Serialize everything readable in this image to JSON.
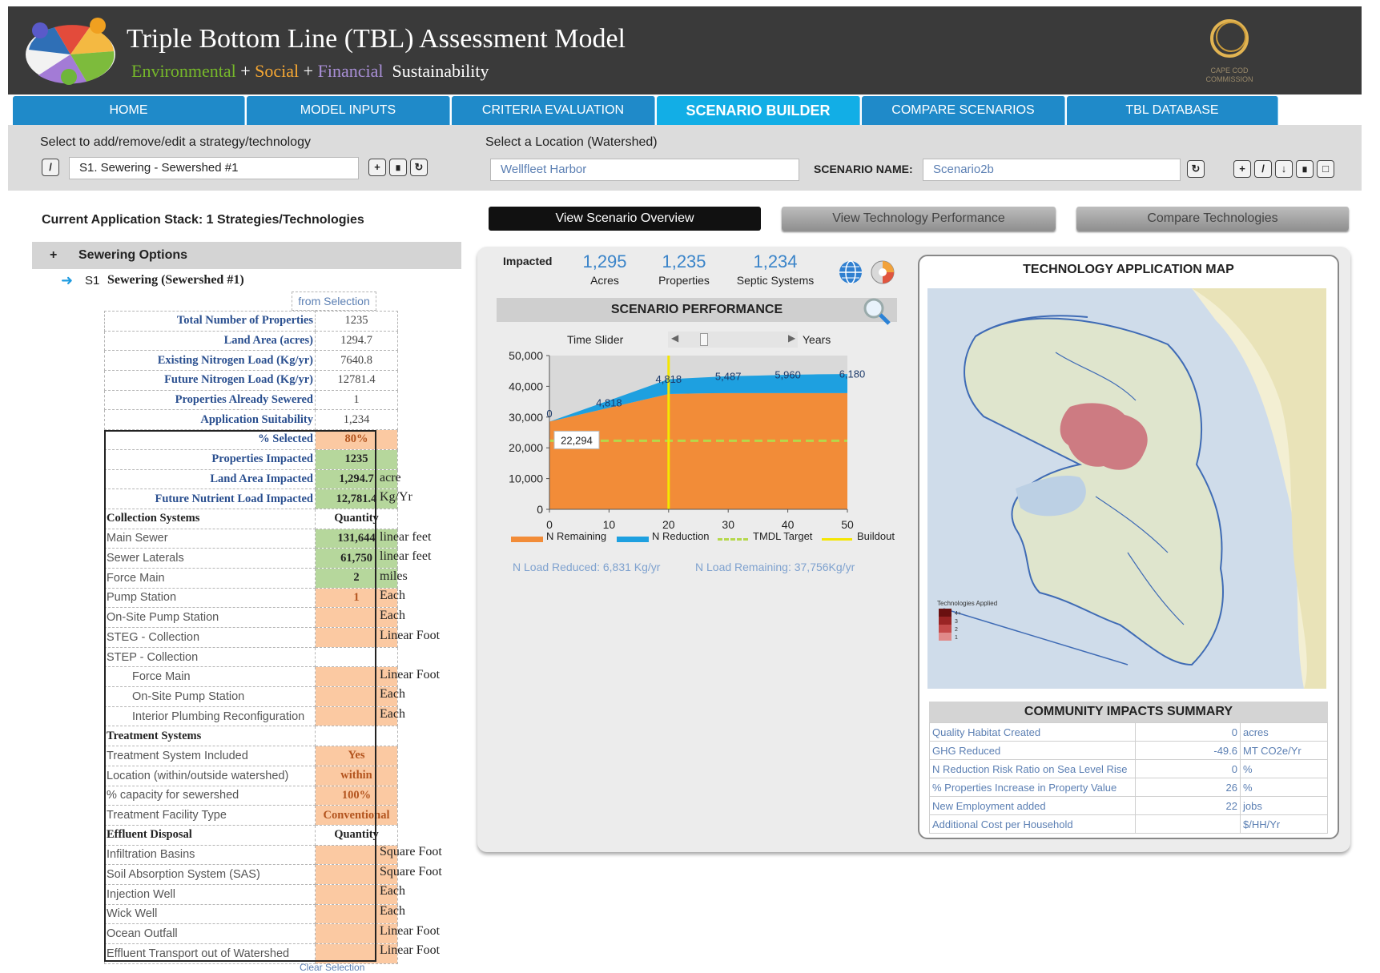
{
  "app": {
    "title": "Triple Bottom Line (TBL) Assessment Model",
    "subtitle": {
      "environmental": "Environmental",
      "social": "Social",
      "financial": "Financial",
      "sustainability": "Sustainability",
      "plus": "+"
    },
    "commission_logo": "CAPE COD COMMISSION"
  },
  "nav": {
    "tabs": [
      {
        "label": "HOME",
        "active": false
      },
      {
        "label": "MODEL INPUTS",
        "active": false
      },
      {
        "label": "CRITERIA EVALUATION",
        "active": false
      },
      {
        "label": "SCENARIO BUILDER",
        "active": true
      },
      {
        "label": "COMPARE SCENARIOS",
        "active": false
      },
      {
        "label": "TBL DATABASE",
        "active": false
      }
    ]
  },
  "toolbar": {
    "strategy_label": "Select to add/remove/edit a strategy/technology",
    "strategy_value": "S1. Sewering - Sewershed #1",
    "location_label": "Select a Location (Watershed)",
    "location_value": "Wellfleet Harbor",
    "scenario_name_label": "SCENARIO NAME:",
    "scenario_name_value": "Scenario2b"
  },
  "left": {
    "stack_title": "Current Application Stack: 1 Strategies/Technologies",
    "group": {
      "toggle": "+",
      "label": "Sewering Options"
    },
    "item": {
      "code": "S1",
      "label": "Sewering (Sewershed #1)"
    },
    "from_selection": "from Selection",
    "clear_selection": "Clear Selection",
    "rows": [
      {
        "label": "Total Number of Properties",
        "value": "1235",
        "unit": "",
        "type": "info"
      },
      {
        "label": "Land Area (acres)",
        "value": "1294.7",
        "unit": "",
        "type": "info"
      },
      {
        "label": "Existing Nitrogen Load (Kg/yr)",
        "value": "7640.8",
        "unit": "",
        "type": "info"
      },
      {
        "label": "Future Nitrogen Load (Kg/yr)",
        "value": "12781.4",
        "unit": "",
        "type": "info"
      },
      {
        "label": "Properties Already Sewered",
        "value": "1",
        "unit": "",
        "type": "info"
      },
      {
        "label": "Application Suitability",
        "value": "1,234",
        "unit": "",
        "type": "info"
      },
      {
        "label": "% Selected",
        "value": "80%",
        "unit": "",
        "type": "orange"
      },
      {
        "label": "Properties Impacted",
        "value": "1235",
        "unit": "",
        "type": "green"
      },
      {
        "label": "Land Area Impacted",
        "value": "1,294.7",
        "unit": "acre",
        "type": "green"
      },
      {
        "label": "Future Nutrient Load Impacted",
        "value": "12,781.4",
        "unit": "Kg/Yr",
        "type": "green"
      },
      {
        "label": "Collection Systems",
        "value": "Quantity",
        "unit": "",
        "type": "section"
      },
      {
        "label": "Main Sewer",
        "value": "131,644",
        "unit": "linear feet",
        "type": "green-sub"
      },
      {
        "label": "Sewer Laterals",
        "value": "61,750",
        "unit": "linear feet",
        "type": "green-sub"
      },
      {
        "label": "Force Main",
        "value": "2",
        "unit": "miles",
        "type": "green-sub"
      },
      {
        "label": "Pump Station",
        "value": "1",
        "unit": "Each",
        "type": "orange-sub"
      },
      {
        "label": "On-Site Pump Station",
        "value": "",
        "unit": "Each",
        "type": "orange-sub"
      },
      {
        "label": "STEG - Collection",
        "value": "",
        "unit": "Linear Foot",
        "type": "orange-sub"
      },
      {
        "label": "STEP - Collection",
        "value": "",
        "unit": "",
        "type": "plain-sub"
      },
      {
        "label": "Force Main",
        "value": "",
        "unit": "Linear Foot",
        "type": "orange-ind"
      },
      {
        "label": "On-Site Pump Station",
        "value": "",
        "unit": "Each",
        "type": "orange-ind"
      },
      {
        "label": "Interior Plumbing Reconfiguration",
        "value": "",
        "unit": "Each",
        "type": "orange-ind"
      },
      {
        "label": "Treatment Systems",
        "value": "",
        "unit": "",
        "type": "section"
      },
      {
        "label": "Treatment System Included",
        "value": "Yes",
        "unit": "",
        "type": "orange-sub"
      },
      {
        "label": "Location (within/outside watershed)",
        "value": "within",
        "unit": "",
        "type": "orange-sub"
      },
      {
        "label": "% capacity for sewershed",
        "value": "100%",
        "unit": "",
        "type": "orange-sub"
      },
      {
        "label": "Treatment Facility Type",
        "value": "Conventional",
        "unit": "",
        "type": "orange-sub"
      },
      {
        "label": "Effluent Disposal",
        "value": "Quantity",
        "unit": "",
        "type": "section"
      },
      {
        "label": "Infiltration Basins",
        "value": "",
        "unit": "Square Foot",
        "type": "orange-sub"
      },
      {
        "label": "Soil Absorption System (SAS)",
        "value": "",
        "unit": "Square Foot",
        "type": "orange-sub"
      },
      {
        "label": "Injection Well",
        "value": "",
        "unit": "Each",
        "type": "orange-sub"
      },
      {
        "label": "Wick Well",
        "value": "",
        "unit": "Each",
        "type": "orange-sub"
      },
      {
        "label": "Ocean Outfall",
        "value": "",
        "unit": "Linear Foot",
        "type": "orange-sub"
      },
      {
        "label": "Effluent Transport out of Watershed",
        "value": "",
        "unit": "Linear Foot",
        "type": "orange-sub"
      }
    ]
  },
  "views": {
    "overview": "View Scenario Overview",
    "performance": "View Technology Performance",
    "compare": "Compare Technologies"
  },
  "impacted": {
    "label": "Impacted",
    "acres_value": "1,295",
    "acres_label": "Acres",
    "properties_value": "1,235",
    "properties_label": "Properties",
    "septic_value": "1,234",
    "septic_label": "Septic Systems"
  },
  "performance": {
    "title": "SCENARIO PERFORMANCE",
    "time_slider": "Time Slider",
    "years": "Years",
    "n_load_reduced": "N Load Reduced: 6,831 Kg/yr",
    "n_load_remaining": "N Load Remaining: 37,756Kg/yr"
  },
  "chart_data": {
    "type": "area",
    "x": [
      0,
      20,
      25,
      30,
      35,
      40,
      45,
      50
    ],
    "xlim": [
      0,
      50
    ],
    "ylim": [
      0,
      50000
    ],
    "xticks": [
      "0",
      "10",
      "20",
      "30",
      "40",
      "50"
    ],
    "yticks": [
      "0",
      "10,000",
      "20,000",
      "30,000",
      "40,000",
      "50,000"
    ],
    "series": [
      {
        "name": "N Remaining",
        "color": "#f28c38",
        "values": [
          28500,
          37500,
          37700,
          37800,
          37800,
          37800,
          37800,
          37800
        ]
      },
      {
        "name": "N Reduction",
        "color": "#1ea0e0",
        "values": [
          0,
          4818,
          5100,
          5487,
          5700,
          5960,
          6100,
          6180
        ]
      }
    ],
    "lines": [
      {
        "name": "TMDL Target",
        "value": 22294,
        "color": "#b5d84a",
        "dashed": true
      },
      {
        "name": "Buildout",
        "x": 20,
        "color": "#f5e600"
      }
    ],
    "data_labels": [
      "0",
      "4,818",
      "4,818",
      "5,487",
      "5,960",
      "6,180",
      "22,294"
    ],
    "legend": [
      "N Remaining",
      "N Reduction",
      "TMDL Target",
      "Buildout"
    ],
    "legend_position": "bottom"
  },
  "map": {
    "title": "TECHNOLOGY APPLICATION MAP",
    "legend_title": "Technologies Applied",
    "legend_items": [
      "4+",
      "3",
      "2",
      "1"
    ]
  },
  "community": {
    "title": "COMMUNITY IMPACTS SUMMARY",
    "rows": [
      {
        "label": "Quality Habitat Created",
        "value": "0",
        "unit": "acres"
      },
      {
        "label": "GHG Reduced",
        "value": "-49.6",
        "unit": "MT CO2e/Yr"
      },
      {
        "label": "N Reduction Risk Ratio on Sea Level Rise",
        "value": "0",
        "unit": "%"
      },
      {
        "label": "% Properties Increase in Property Value",
        "value": "26",
        "unit": "%"
      },
      {
        "label": "New Employment added",
        "value": "22",
        "unit": "jobs"
      },
      {
        "label": "Additional Cost per Household",
        "value": "",
        "unit": "$/HH/Yr"
      }
    ]
  }
}
